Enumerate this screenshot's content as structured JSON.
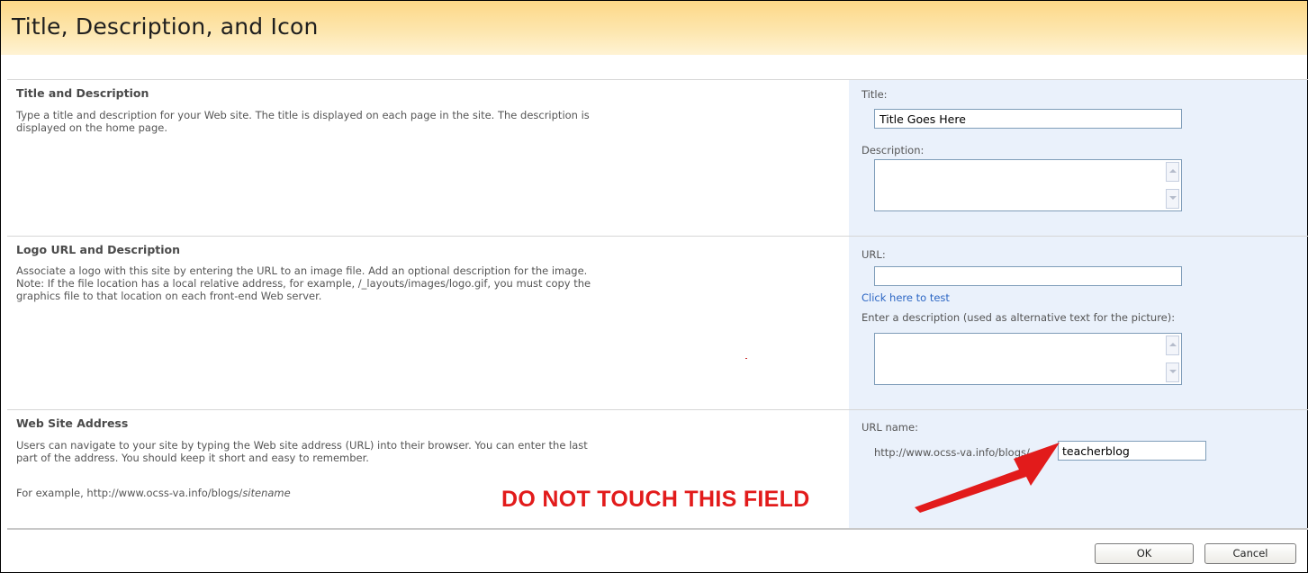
{
  "header": {
    "title": "Title, Description, and Icon"
  },
  "sections": {
    "title_desc": {
      "heading": "Title and Description",
      "description": "Type a title and description for your Web site. The title is displayed on each page in the site. The description is displayed on the home page.",
      "title_label": "Title:",
      "title_value": "Title Goes Here",
      "description_label": "Description:"
    },
    "logo": {
      "heading": "Logo URL and Description",
      "description": "Associate a logo with this site by entering the URL to an image file. Add an optional description for the image. Note: If the file location has a local relative address, for example, /_layouts/images/logo.gif, you must copy the graphics file to that location on each front-end Web server.",
      "url_label": "URL:",
      "test_link": "Click here to test",
      "alt_label": "Enter a description (used as alternative text for the picture):"
    },
    "address": {
      "heading": "Web Site Address",
      "description": "Users can navigate to your site by typing the Web site address (URL) into their browser. You can enter the last part of the address. You should keep it short and easy to remember.",
      "example_prefix": "For example, http://www.ocss-va.info/blogs/",
      "example_italic": "sitename",
      "url_name_label": "URL name:",
      "url_prefix": "http://www.ocss-va.info/blogs/",
      "url_name_value": "teacherblog"
    }
  },
  "annotation": {
    "warning": "DO NOT TOUCH THIS FIELD",
    "color": "#e21b1b"
  },
  "buttons": {
    "ok": "OK",
    "cancel": "Cancel"
  },
  "colors": {
    "header_bg": "#fdd887",
    "right_panel_bg": "#eaf1fb",
    "link": "#2c66c4"
  }
}
